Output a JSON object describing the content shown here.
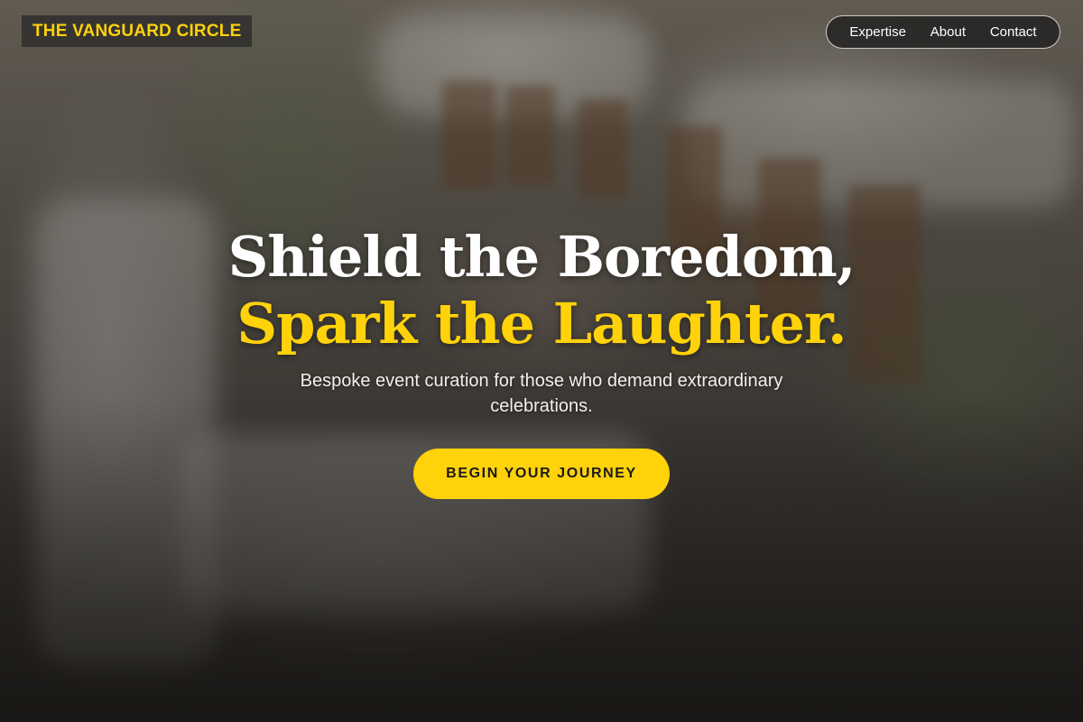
{
  "brand": {
    "name": "THE VANGUARD CIRCLE",
    "color": "#ffd20a"
  },
  "nav": {
    "items": [
      {
        "label": "Expertise"
      },
      {
        "label": "About"
      },
      {
        "label": "Contact"
      }
    ]
  },
  "hero": {
    "headline_line1": "Shield the Boredom,",
    "headline_line2": "Spark the Laughter.",
    "subtitle": "Bespoke event curation for those who demand extraordinary celebrations.",
    "cta_label": "BEGIN YOUR JOURNEY"
  },
  "colors": {
    "accent": "#ffd20a",
    "text_primary": "#ffffff",
    "nav_background": "#1e1e1e"
  }
}
